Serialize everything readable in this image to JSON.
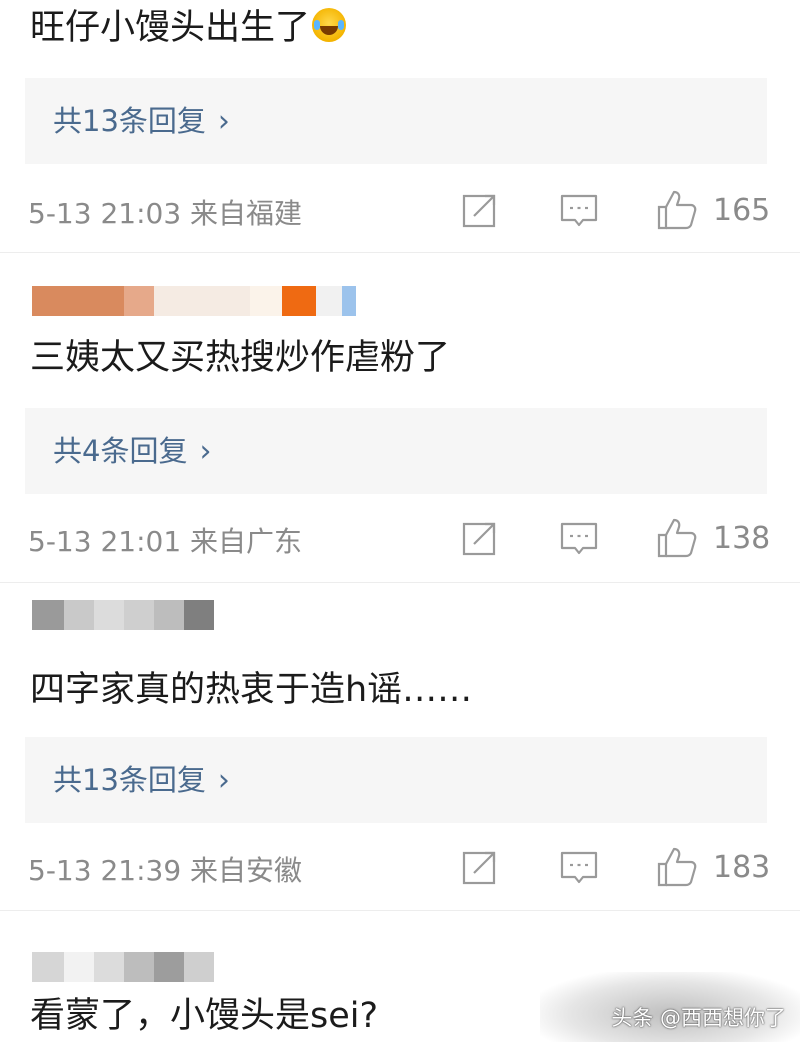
{
  "comments": [
    {
      "text": "旺仔小馒头出生了",
      "emoji": "laughing-tears-emoji",
      "replies_label": "共13条回复",
      "time_location": "5-13 21:03 来自福建",
      "likes": "165"
    },
    {
      "text": "三姨太又买热搜炒作虐粉了",
      "replies_label": "共4条回复",
      "time_location": "5-13 21:01 来自广东",
      "likes": "138"
    },
    {
      "text": "四字家真的热衷于造h谣……",
      "replies_label": "共13条回复",
      "time_location": "5-13 21:39 来自安徽",
      "likes": "183"
    },
    {
      "text": "看蒙了，小馒头是sei?"
    }
  ],
  "reply_chevron": "›",
  "icons": {
    "share": "share-icon",
    "comment": "comment-icon",
    "like": "thumbs-up-icon"
  },
  "colors": {
    "reply_link": "#4a6a8e",
    "meta_text": "#8a8a8a",
    "reply_bg": "#f6f6f6"
  },
  "watermark": "头条 @西西想你了"
}
